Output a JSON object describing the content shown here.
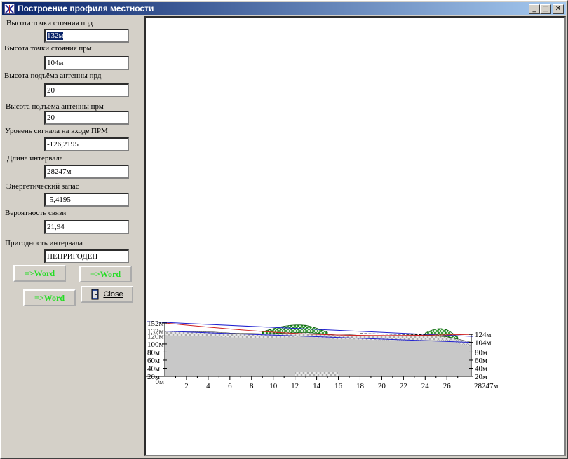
{
  "window": {
    "title": "Построение профиля местности",
    "controls": {
      "minimize": "_",
      "maximize": "□",
      "close": "✕"
    }
  },
  "fields": [
    {
      "label": "Высота точки стояния прд",
      "value": "132м"
    },
    {
      "label": "Высота точки стояния прм",
      "value": "104м"
    },
    {
      "label": "Высота подъёма антенны прд",
      "value": "20"
    },
    {
      "label": "Высота подъёма антенны прм",
      "value": "20"
    },
    {
      "label": "Уровень сигнала на входе ПРМ",
      "value": "-126,2195"
    },
    {
      "label": "Длина интервала",
      "value": "28247м"
    },
    {
      "label": "Энергетический запас",
      "value": "-5,4195"
    },
    {
      "label": "Вероятность связи",
      "value": "21,94"
    },
    {
      "label": "Пригодность интервала",
      "value": "НЕПРИГОДЕН"
    }
  ],
  "buttons": {
    "word_1": "=>Word",
    "word_2": "=>Word",
    "word_3": "=>Word",
    "close": "Close"
  },
  "chart_data": {
    "type": "area",
    "title": "",
    "left_axis_labels": [
      "152м",
      "132м",
      "120м",
      "100м",
      "80м",
      "60м",
      "40м",
      "20м"
    ],
    "right_axis_labels": [
      "124м",
      "104м",
      "80м",
      "60м",
      "40м",
      "20м"
    ],
    "x_start_label": "0м",
    "x_end_label": "28247м",
    "x_ticks": [
      "2",
      "4",
      "6",
      "8",
      "10",
      "12",
      "14",
      "16",
      "18",
      "20",
      "22",
      "24",
      "26"
    ],
    "x_range_km": [
      0,
      28.247
    ],
    "y_range_m": [
      20,
      152
    ],
    "terrain_profile": {
      "x_km": [
        0,
        2,
        4,
        5.5,
        6,
        8,
        9,
        10,
        12,
        13,
        14,
        15,
        16,
        17,
        18,
        20,
        22,
        23.5,
        24,
        25,
        26,
        27,
        28.247
      ],
      "elevation_m": [
        132,
        131,
        130,
        128,
        127,
        126,
        125,
        126,
        128,
        129,
        127,
        124,
        122,
        123,
        121,
        120,
        119,
        119,
        122,
        120,
        118,
        112,
        104
      ]
    },
    "forest_segments_km": [
      [
        9,
        15
      ],
      [
        24,
        27
      ]
    ],
    "line_of_sight_m": {
      "start": 152,
      "end": 124
    },
    "refraction_curve_color": "#d02020",
    "los_color": "#2020d0",
    "terrain_fill_color": "#c8c8c8",
    "forest_color": "#1a8a1a"
  }
}
